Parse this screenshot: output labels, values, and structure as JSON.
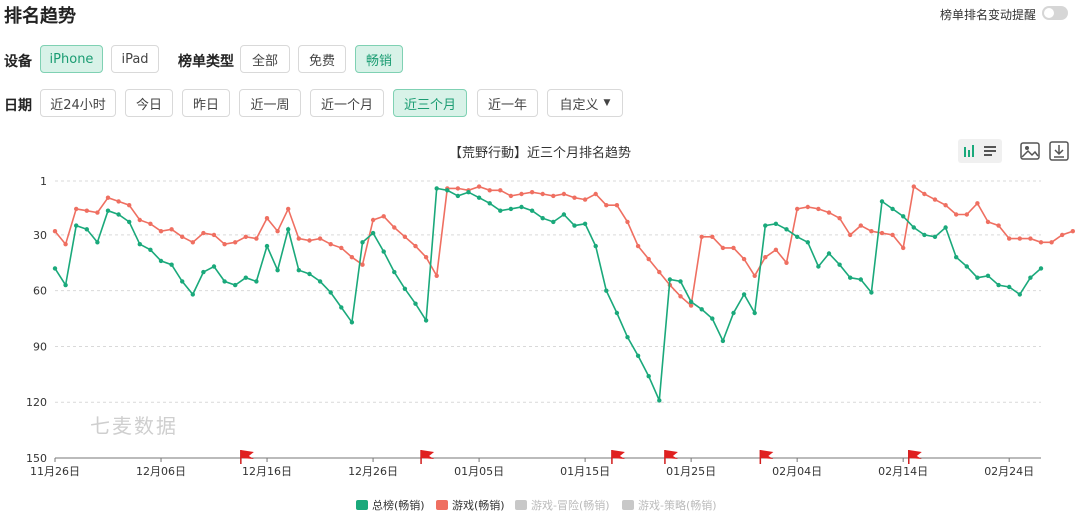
{
  "header": {
    "title": "排名趋势",
    "toggle_label": "榜单排名变动提醒"
  },
  "filters": {
    "device_label": "设备",
    "devices": [
      "iPhone",
      "iPad"
    ],
    "list_type_label": "榜单类型",
    "list_types": [
      "全部",
      "免费",
      "畅销"
    ],
    "date_label": "日期",
    "dates": [
      "近24小时",
      "今日",
      "昨日",
      "近一周",
      "近一个月",
      "近三个月",
      "近一年",
      "自定义"
    ]
  },
  "watermark": "七麦数据",
  "colors": {
    "total": "#1aa97b",
    "game": "#ef6f61",
    "disabled": "#c8c8c8",
    "active_bg": "#d8f2e8",
    "active_text": "#1a9c72"
  },
  "chart_data": {
    "type": "line",
    "title": "【荒野行動】近三个月排名趋势",
    "y_inverted": true,
    "ylim": [
      1,
      150
    ],
    "yticks": [
      1,
      30,
      60,
      90,
      120,
      150
    ],
    "x_tick_labels": [
      "11月26日",
      "12月06日",
      "12月16日",
      "12月26日",
      "01月05日",
      "01月15日",
      "01月25日",
      "02月04日",
      "02月14日",
      "02月24日"
    ],
    "x_tick_index": [
      0,
      10,
      20,
      30,
      40,
      50,
      60,
      70,
      80,
      90
    ],
    "flag_index": [
      18,
      35,
      53,
      58,
      67,
      81
    ],
    "grid": true,
    "legend_position": "bottom",
    "series": [
      {
        "name": "总榜(畅销)",
        "active": true,
        "values": [
          48,
          57,
          25,
          27,
          34,
          17,
          19,
          23,
          35,
          38,
          44,
          46,
          55,
          62,
          50,
          47,
          55,
          57,
          53,
          55,
          36,
          49,
          27,
          49,
          51,
          55,
          61,
          69,
          77,
          34,
          29,
          39,
          50,
          59,
          67,
          76,
          5,
          6,
          9,
          7,
          10,
          13,
          17,
          16,
          15,
          17,
          21,
          23,
          19,
          25,
          24,
          36,
          60,
          72,
          85,
          95,
          106,
          119,
          54,
          55,
          66,
          70,
          75,
          87,
          72,
          62,
          72,
          25,
          24,
          27,
          31,
          34,
          47,
          40,
          46,
          53,
          54,
          61,
          12,
          16,
          20,
          26,
          30,
          31,
          26,
          42,
          47,
          53,
          52,
          57,
          58,
          62,
          53,
          48
        ]
      },
      {
        "name": "游戏(畅销)",
        "active": true,
        "values": [
          28,
          35,
          16,
          17,
          18,
          10,
          12,
          14,
          22,
          24,
          28,
          27,
          31,
          34,
          29,
          30,
          35,
          34,
          31,
          32,
          21,
          28,
          16,
          32,
          33,
          32,
          35,
          37,
          42,
          46,
          22,
          20,
          26,
          31,
          36,
          42,
          52,
          5,
          5,
          6,
          4,
          6,
          6,
          9,
          8,
          7,
          8,
          9,
          8,
          10,
          11,
          8,
          14,
          14,
          23,
          36,
          43,
          50,
          57,
          63,
          68,
          31,
          31,
          37,
          37,
          43,
          52,
          42,
          38,
          45,
          16,
          15,
          16,
          18,
          21,
          30,
          25,
          28,
          29,
          30,
          37,
          4,
          8,
          11,
          14,
          19,
          19,
          13,
          23,
          25,
          32,
          32,
          32,
          34,
          34,
          30,
          28
        ]
      },
      {
        "name": "游戏-冒险(畅销)",
        "active": false,
        "values": []
      },
      {
        "name": "游戏-策略(畅销)",
        "active": false,
        "values": []
      }
    ]
  }
}
